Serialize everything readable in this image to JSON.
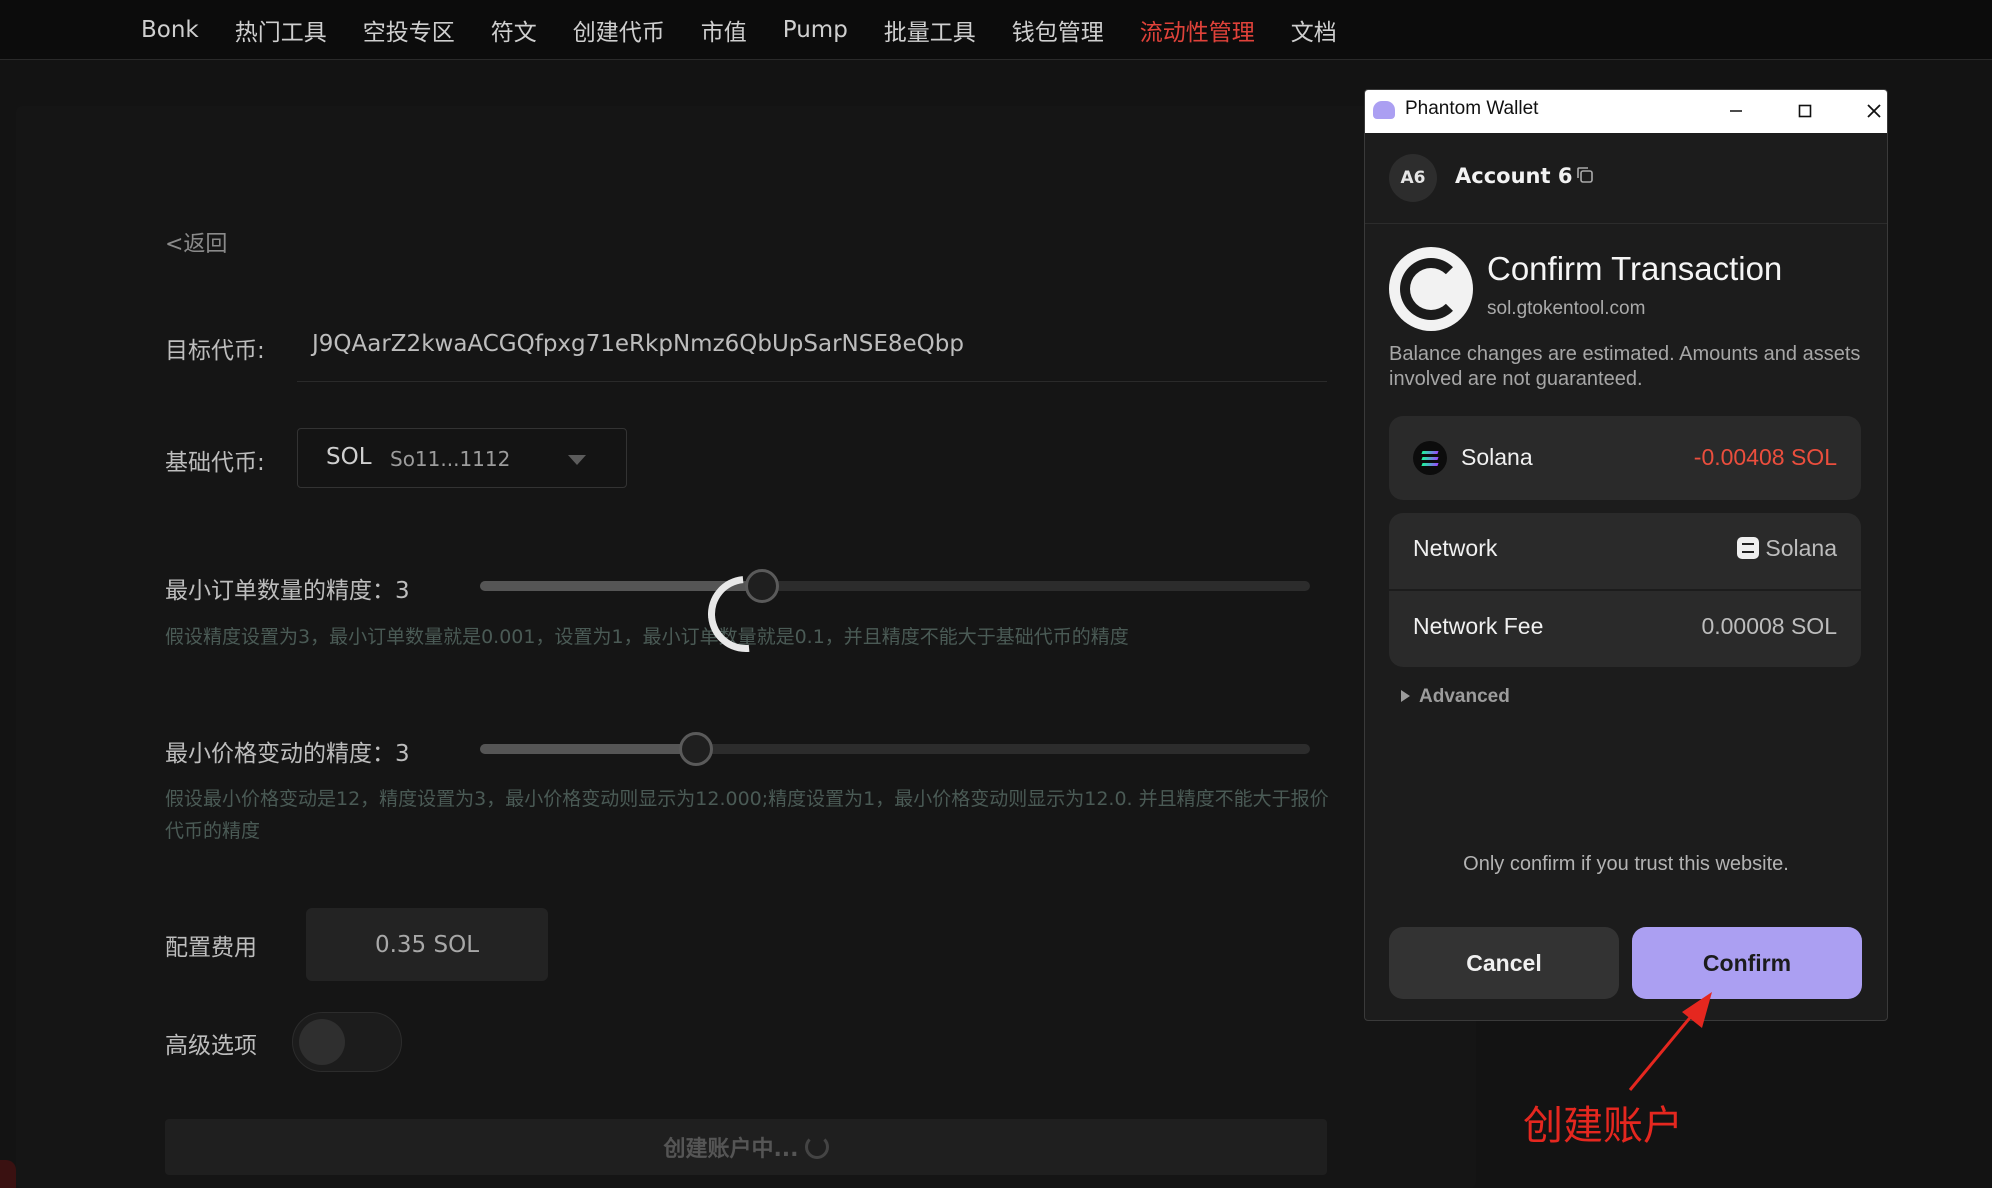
{
  "nav": {
    "items": [
      "Bonk",
      "热门工具",
      "空投专区",
      "符文",
      "创建代币",
      "市值",
      "Pump",
      "批量工具",
      "钱包管理",
      "流动性管理",
      "文档"
    ],
    "active": "流动性管理",
    "active_color": "#e0423a"
  },
  "form": {
    "back_label": "<返回",
    "target_label": "目标代币:",
    "target_value": "J9QAarZ2kwaACGQfpxg71eRkpNmz6QbUpSarNSE8eQbp",
    "base_label": "基础代币:",
    "base_symbol": "SOL",
    "base_address": "So11...1112",
    "lot_label": "最小订单数量的精度：3",
    "lot_value": 3,
    "lot_slider_fraction": 0.34,
    "lot_hint": "假设精度设置为3，最小订单数量就是0.001，设置为1，最小订单数量就是0.1，并且精度不能大于基础代币的精度",
    "tick_label": "最小价格变动的精度：3",
    "tick_value": 3,
    "tick_slider_fraction": 0.26,
    "tick_hint": "假设最小价格变动是12，精度设置为3，最小价格变动则显示为12.000;精度设置为1，最小价格变动则显示为12.0. 并且精度不能大于报价代币的精度",
    "fee_label": "配置费用",
    "fee_value": "0.35 SOL",
    "advanced_label": "高级选项",
    "advanced_enabled": false,
    "submit_label": "创建账户中..."
  },
  "wallet": {
    "window_title": "Phantom Wallet",
    "account_initials": "A6",
    "account_name": "Account 6",
    "title": "Confirm Transaction",
    "site": "sol.gtokentool.com",
    "note": "Balance changes are estimated. Amounts and assets involved are not guaranteed.",
    "balance_asset": "Solana",
    "balance_change": "-0.00408 SOL",
    "network_label": "Network",
    "network_value": "Solana",
    "fee_label": "Network Fee",
    "fee_value": "0.00008 SOL",
    "advanced_label": "Advanced",
    "trust_note": "Only confirm if you trust this website.",
    "cancel_label": "Cancel",
    "confirm_label": "Confirm",
    "accent_color": "#ab9ff2",
    "negative_color": "#eb4e3d"
  },
  "annotation": {
    "text": "创建账户",
    "color": "#e5271f"
  }
}
